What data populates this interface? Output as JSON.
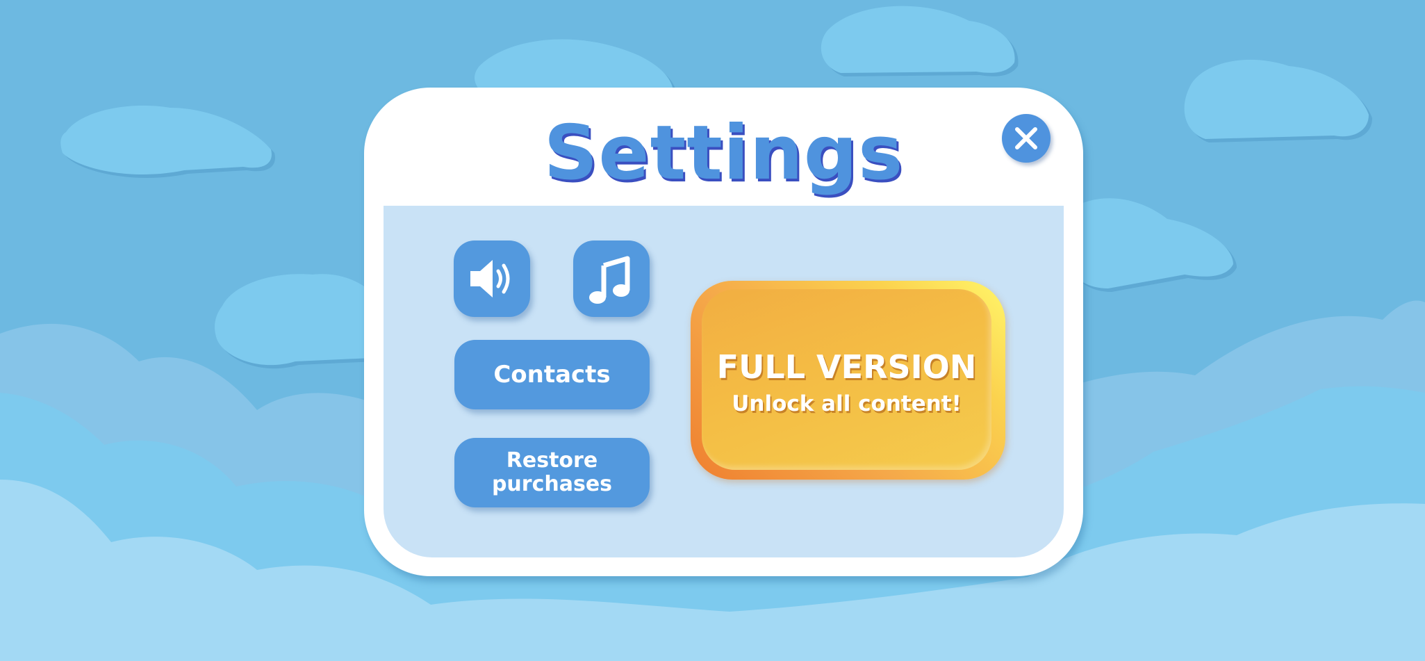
{
  "settings_dialog": {
    "title": "Settings",
    "close_icon": "close-icon",
    "sound_toggle_icon": "speaker-icon",
    "music_toggle_icon": "music-note-icon",
    "contacts_label": "Contacts",
    "restore_label_line1": "Restore",
    "restore_label_line2": "purchases",
    "full_version": {
      "title": "FULL VERSION",
      "subtitle": "Unlock all content!"
    }
  },
  "colors": {
    "sky": "#6db9e1",
    "cloud": "#7dcaee",
    "button_blue": "#5399de",
    "panel_inner": "#c9e2f6",
    "title_blue": "#4f93de",
    "promo_orange": "#f2ae42"
  }
}
